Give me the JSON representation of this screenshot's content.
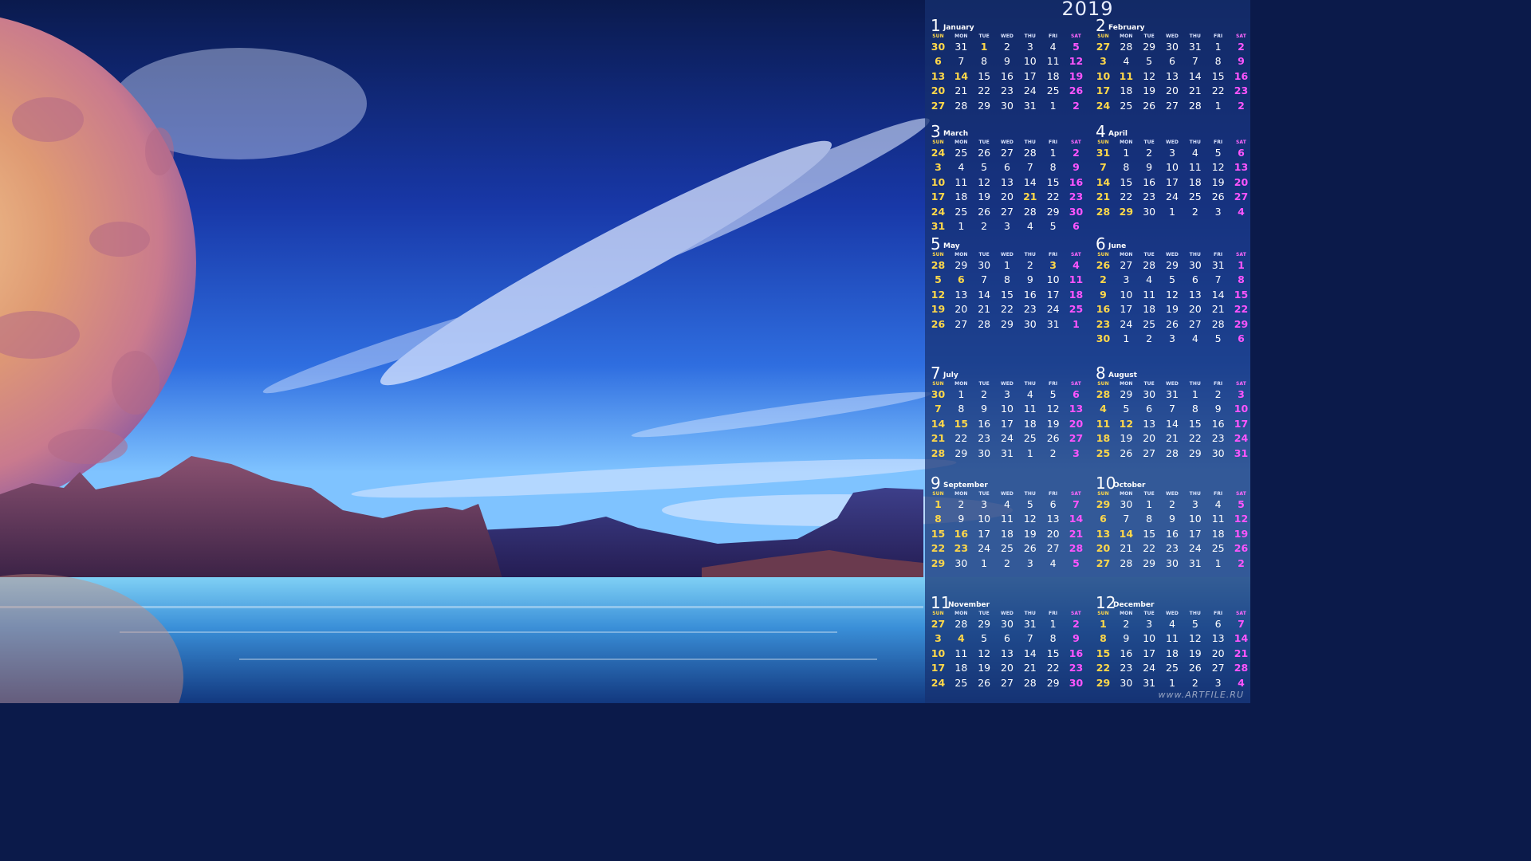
{
  "calendar": {
    "year": "2019",
    "dow": [
      "SUN",
      "MON",
      "TUE",
      "WED",
      "THU",
      "FRI",
      "SAT"
    ],
    "months": [
      {
        "num": "1",
        "name": "January",
        "weeks": [
          [
            "30",
            "31",
            "1",
            "2",
            "3",
            "4",
            "5"
          ],
          [
            "6",
            "7",
            "8",
            "9",
            "10",
            "11",
            "12"
          ],
          [
            "13",
            "14",
            "15",
            "16",
            "17",
            "18",
            "19"
          ],
          [
            "20",
            "21",
            "22",
            "23",
            "24",
            "25",
            "26"
          ],
          [
            "27",
            "28",
            "29",
            "30",
            "31",
            "1",
            "2"
          ]
        ],
        "holidays": [
          "1",
          "14"
        ]
      },
      {
        "num": "2",
        "name": "February",
        "weeks": [
          [
            "27",
            "28",
            "29",
            "30",
            "31",
            "1",
            "2"
          ],
          [
            "3",
            "4",
            "5",
            "6",
            "7",
            "8",
            "9"
          ],
          [
            "10",
            "11",
            "12",
            "13",
            "14",
            "15",
            "16"
          ],
          [
            "17",
            "18",
            "19",
            "20",
            "21",
            "22",
            "23"
          ],
          [
            "24",
            "25",
            "26",
            "27",
            "28",
            "1",
            "2"
          ]
        ],
        "holidays": [
          "11"
        ]
      },
      {
        "num": "3",
        "name": "March",
        "weeks": [
          [
            "24",
            "25",
            "26",
            "27",
            "28",
            "1",
            "2"
          ],
          [
            "3",
            "4",
            "5",
            "6",
            "7",
            "8",
            "9"
          ],
          [
            "10",
            "11",
            "12",
            "13",
            "14",
            "15",
            "16"
          ],
          [
            "17",
            "18",
            "19",
            "20",
            "21",
            "22",
            "23"
          ],
          [
            "24",
            "25",
            "26",
            "27",
            "28",
            "29",
            "30"
          ],
          [
            "31",
            "1",
            "2",
            "3",
            "4",
            "5",
            "6"
          ]
        ],
        "holidays": [
          "21"
        ]
      },
      {
        "num": "4",
        "name": "April",
        "weeks": [
          [
            "31",
            "1",
            "2",
            "3",
            "4",
            "5",
            "6"
          ],
          [
            "7",
            "8",
            "9",
            "10",
            "11",
            "12",
            "13"
          ],
          [
            "14",
            "15",
            "16",
            "17",
            "18",
            "19",
            "20"
          ],
          [
            "21",
            "22",
            "23",
            "24",
            "25",
            "26",
            "27"
          ],
          [
            "28",
            "29",
            "30",
            "1",
            "2",
            "3",
            "4"
          ]
        ],
        "holidays": [
          "29"
        ]
      },
      {
        "num": "5",
        "name": "May",
        "weeks": [
          [
            "28",
            "29",
            "30",
            "1",
            "2",
            "3",
            "4"
          ],
          [
            "5",
            "6",
            "7",
            "8",
            "9",
            "10",
            "11"
          ],
          [
            "12",
            "13",
            "14",
            "15",
            "16",
            "17",
            "18"
          ],
          [
            "19",
            "20",
            "21",
            "22",
            "23",
            "24",
            "25"
          ],
          [
            "26",
            "27",
            "28",
            "29",
            "30",
            "31",
            "1"
          ]
        ],
        "holidays": [
          "3",
          "4",
          "6"
        ]
      },
      {
        "num": "6",
        "name": "June",
        "weeks": [
          [
            "26",
            "27",
            "28",
            "29",
            "30",
            "31",
            "1"
          ],
          [
            "2",
            "3",
            "4",
            "5",
            "6",
            "7",
            "8"
          ],
          [
            "9",
            "10",
            "11",
            "12",
            "13",
            "14",
            "15"
          ],
          [
            "16",
            "17",
            "18",
            "19",
            "20",
            "21",
            "22"
          ],
          [
            "23",
            "24",
            "25",
            "26",
            "27",
            "28",
            "29"
          ],
          [
            "30",
            "1",
            "2",
            "3",
            "4",
            "5",
            "6"
          ]
        ],
        "holidays": []
      },
      {
        "num": "7",
        "name": "July",
        "weeks": [
          [
            "30",
            "1",
            "2",
            "3",
            "4",
            "5",
            "6"
          ],
          [
            "7",
            "8",
            "9",
            "10",
            "11",
            "12",
            "13"
          ],
          [
            "14",
            "15",
            "16",
            "17",
            "18",
            "19",
            "20"
          ],
          [
            "21",
            "22",
            "23",
            "24",
            "25",
            "26",
            "27"
          ],
          [
            "28",
            "29",
            "30",
            "31",
            "1",
            "2",
            "3"
          ]
        ],
        "holidays": [
          "15"
        ]
      },
      {
        "num": "8",
        "name": "August",
        "weeks": [
          [
            "28",
            "29",
            "30",
            "31",
            "1",
            "2",
            "3"
          ],
          [
            "4",
            "5",
            "6",
            "7",
            "8",
            "9",
            "10"
          ],
          [
            "11",
            "12",
            "13",
            "14",
            "15",
            "16",
            "17"
          ],
          [
            "18",
            "19",
            "20",
            "21",
            "22",
            "23",
            "24"
          ],
          [
            "25",
            "26",
            "27",
            "28",
            "29",
            "30",
            "31"
          ]
        ],
        "holidays": [
          "12"
        ]
      },
      {
        "num": "9",
        "name": "September",
        "weeks": [
          [
            "1",
            "2",
            "3",
            "4",
            "5",
            "6",
            "7"
          ],
          [
            "8",
            "9",
            "10",
            "11",
            "12",
            "13",
            "14"
          ],
          [
            "15",
            "16",
            "17",
            "18",
            "19",
            "20",
            "21"
          ],
          [
            "22",
            "23",
            "24",
            "25",
            "26",
            "27",
            "28"
          ],
          [
            "29",
            "30",
            "1",
            "2",
            "3",
            "4",
            "5"
          ]
        ],
        "holidays": [
          "16",
          "23"
        ]
      },
      {
        "num": "10",
        "name": "October",
        "weeks": [
          [
            "29",
            "30",
            "1",
            "2",
            "3",
            "4",
            "5"
          ],
          [
            "6",
            "7",
            "8",
            "9",
            "10",
            "11",
            "12"
          ],
          [
            "13",
            "14",
            "15",
            "16",
            "17",
            "18",
            "19"
          ],
          [
            "20",
            "21",
            "22",
            "23",
            "24",
            "25",
            "26"
          ],
          [
            "27",
            "28",
            "29",
            "30",
            "31",
            "1",
            "2"
          ]
        ],
        "holidays": [
          "14"
        ]
      },
      {
        "num": "11",
        "name": "November",
        "weeks": [
          [
            "27",
            "28",
            "29",
            "30",
            "31",
            "1",
            "2"
          ],
          [
            "3",
            "4",
            "5",
            "6",
            "7",
            "8",
            "9"
          ],
          [
            "10",
            "11",
            "12",
            "13",
            "14",
            "15",
            "16"
          ],
          [
            "17",
            "18",
            "19",
            "20",
            "21",
            "22",
            "23"
          ],
          [
            "24",
            "25",
            "26",
            "27",
            "28",
            "29",
            "30"
          ]
        ],
        "holidays": [
          "4"
        ]
      },
      {
        "num": "12",
        "name": "December",
        "weeks": [
          [
            "1",
            "2",
            "3",
            "4",
            "5",
            "6",
            "7"
          ],
          [
            "8",
            "9",
            "10",
            "11",
            "12",
            "13",
            "14"
          ],
          [
            "15",
            "16",
            "17",
            "18",
            "19",
            "20",
            "21"
          ],
          [
            "22",
            "23",
            "24",
            "25",
            "26",
            "27",
            "28"
          ],
          [
            "29",
            "30",
            "31",
            "1",
            "2",
            "3",
            "4"
          ]
        ],
        "holidays": []
      }
    ]
  },
  "watermark": "www.ARTFILE.RU",
  "colors": {
    "sunday": "#ffd84a",
    "saturday": "#ff55ff",
    "weekday": "#ffffff",
    "panel": "#163070"
  }
}
